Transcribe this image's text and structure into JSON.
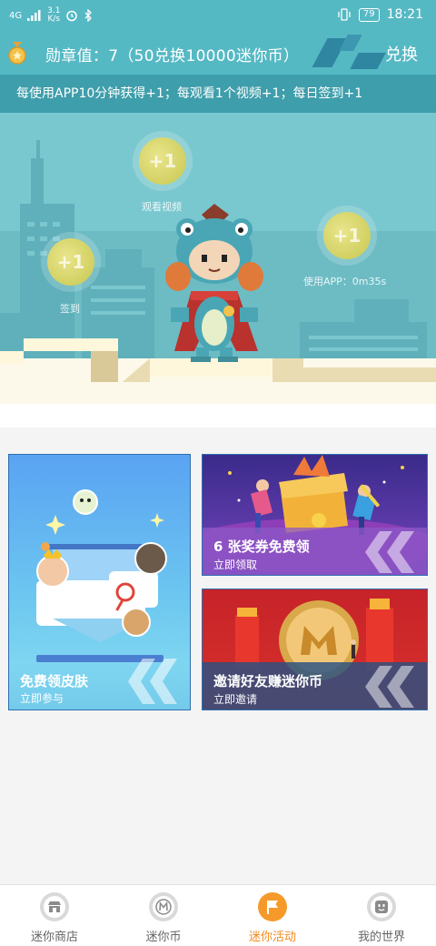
{
  "status_bar": {
    "network": "4G",
    "speed_value": "3.1",
    "speed_unit": "K/s",
    "battery": "79",
    "time": "18:21"
  },
  "header": {
    "medal_title": "勋章值：7（50兑换10000迷你币）",
    "exchange_label": "兑换"
  },
  "hint": "每使用APP10分钟获得+1；每观看1个视频+1；每日签到+1",
  "rewards": [
    {
      "value": "+1",
      "label": "观看视频"
    },
    {
      "value": "+1",
      "label": "签到"
    },
    {
      "value": "+1",
      "label": "使用APP：0m35s"
    }
  ],
  "cards": {
    "skin": {
      "title": "免费领皮肤",
      "subtitle": "立即参与"
    },
    "coupon": {
      "title": "6 张奖券免费领",
      "subtitle": "立即领取"
    },
    "invite": {
      "title": "邀请好友赚迷你币",
      "subtitle": "立即邀请"
    }
  },
  "tabs": [
    {
      "label": "迷你商店",
      "icon": "shop-icon"
    },
    {
      "label": "迷你币",
      "icon": "mini-coin-icon"
    },
    {
      "label": "迷你活动",
      "icon": "flag-icon",
      "active": true
    },
    {
      "label": "我的世界",
      "icon": "face-icon"
    }
  ],
  "colors": {
    "accent": "#55b9c4",
    "hint_bar": "#3f9eab",
    "active_tab": "#f08a1c"
  }
}
